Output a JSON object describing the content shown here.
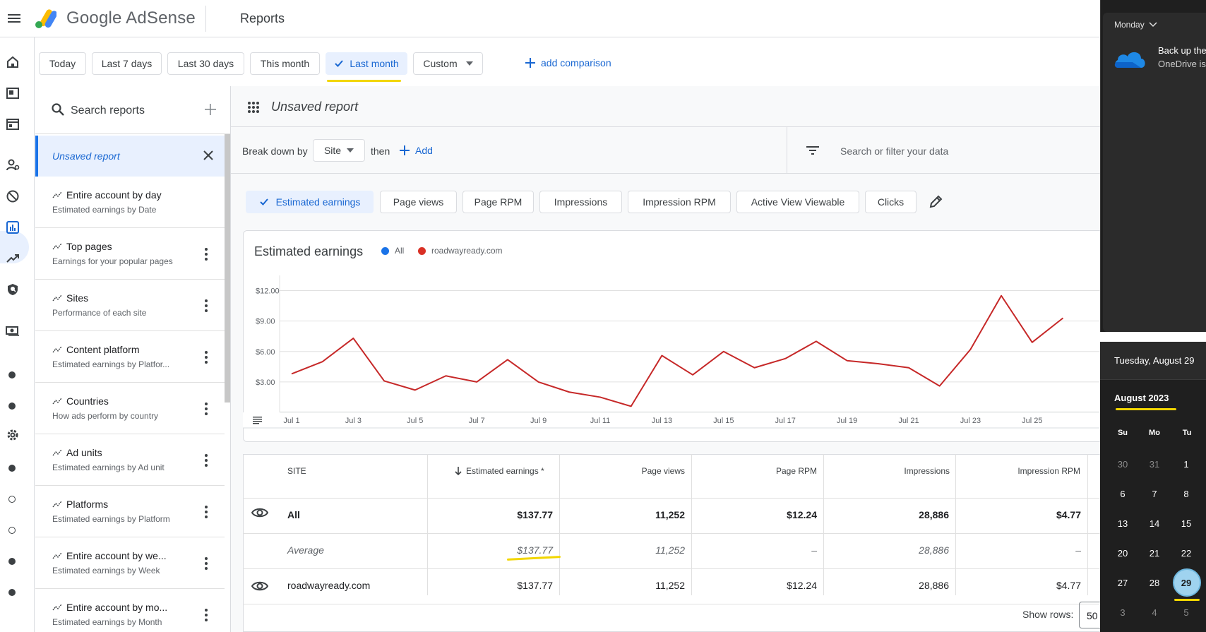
{
  "topbar": {
    "brand": "Google AdSense",
    "page_title": "Reports"
  },
  "date_chips": [
    "Today",
    "Last 7 days",
    "Last 30 days",
    "This month",
    "Last month",
    "Custom"
  ],
  "date_selected": "Last month",
  "add_comparison": "add comparison",
  "sidebar": {
    "search_placeholder": "Search reports",
    "active_item": "Unsaved report",
    "items": [
      {
        "title": "Entire account by day",
        "subtitle": "Estimated earnings by Date"
      },
      {
        "title": "Top pages",
        "subtitle": "Earnings for your popular pages"
      },
      {
        "title": "Sites",
        "subtitle": "Performance of each site"
      },
      {
        "title": "Content platform",
        "subtitle": "Estimated earnings by Platfor..."
      },
      {
        "title": "Countries",
        "subtitle": "How ads perform by country"
      },
      {
        "title": "Ad units",
        "subtitle": "Estimated earnings by Ad unit"
      },
      {
        "title": "Platforms",
        "subtitle": "Estimated earnings by Platform"
      },
      {
        "title": "Entire account by we...",
        "subtitle": "Estimated earnings by Week"
      },
      {
        "title": "Entire account by mo...",
        "subtitle": "Estimated earnings by Month"
      }
    ]
  },
  "report": {
    "title": "Unsaved report",
    "breakdown_label": "Break down by",
    "breakdown_value": "Site",
    "then_label": "then",
    "add_label": "Add",
    "filter_placeholder": "Search or filter your data",
    "metrics": [
      "Estimated earnings",
      "Page views",
      "Page RPM",
      "Impressions",
      "Impression RPM",
      "Active View Viewable",
      "Clicks"
    ],
    "active_metric": "Estimated earnings"
  },
  "chart_data": {
    "type": "line",
    "title": "Estimated earnings",
    "legend": [
      {
        "name": "All",
        "color": "#1a73e8"
      },
      {
        "name": "roadwayready.com",
        "color": "#d93025"
      }
    ],
    "y_ticks": [
      "$12.00",
      "$9.00",
      "$6.00",
      "$3.00"
    ],
    "ylim": [
      0,
      13.5
    ],
    "x_tick_labels": [
      "Jul 1",
      "Jul 3",
      "Jul 5",
      "Jul 7",
      "Jul 9",
      "Jul 11",
      "Jul 13",
      "Jul 15",
      "Jul 17",
      "Jul 19",
      "Jul 21",
      "Jul 23",
      "Jul 25"
    ],
    "x_days": [
      1,
      2,
      3,
      4,
      5,
      6,
      7,
      8,
      9,
      10,
      11,
      12,
      13,
      14,
      15,
      16,
      17,
      18,
      19,
      20,
      21,
      22,
      23,
      24,
      25,
      26
    ],
    "series": [
      {
        "name": "roadwayready.com",
        "color": "#c62828",
        "values": [
          3.8,
          5.0,
          7.3,
          3.1,
          2.2,
          3.6,
          3.0,
          5.2,
          3.0,
          2.0,
          1.5,
          0.6,
          5.6,
          3.7,
          6.0,
          4.4,
          5.3,
          7.0,
          5.1,
          4.8,
          4.4,
          2.6,
          6.2,
          11.5,
          6.9,
          9.3
        ]
      }
    ]
  },
  "table": {
    "headers": [
      "SITE",
      "Estimated earnings *",
      "Page views",
      "Page RPM",
      "Impressions",
      "Impression RPM"
    ],
    "rows": [
      {
        "site": "All",
        "earnings": "$137.77",
        "page_views": "11,252",
        "page_rpm": "$12.24",
        "impressions": "28,886",
        "impression_rpm": "$4.77"
      },
      {
        "site": "Average",
        "earnings": "$137.77",
        "page_views": "11,252",
        "page_rpm": "–",
        "impressions": "28,886",
        "impression_rpm": "–"
      },
      {
        "site": "roadwayready.com",
        "earnings": "$137.77",
        "page_views": "11,252",
        "page_rpm": "$12.24",
        "impressions": "28,886",
        "impression_rpm": "$4.77"
      }
    ],
    "show_rows_label": "Show rows:",
    "show_rows_value": "50"
  },
  "notification": {
    "day": "Monday",
    "line1": "Back up the",
    "line2": "OneDrive is"
  },
  "calendar": {
    "today_label": "Tuesday, August 29",
    "month": "August 2023",
    "weekdays": [
      "Su",
      "Mo",
      "Tu"
    ],
    "weeks": [
      [
        "30",
        "31",
        "1"
      ],
      [
        "6",
        "7",
        "8"
      ],
      [
        "13",
        "14",
        "15"
      ],
      [
        "20",
        "21",
        "22"
      ],
      [
        "27",
        "28",
        "29"
      ],
      [
        "3",
        "4",
        "5"
      ]
    ]
  },
  "colors": {
    "accent": "#1a73e8",
    "line": "#c62828",
    "highlight": "#f2d600"
  }
}
